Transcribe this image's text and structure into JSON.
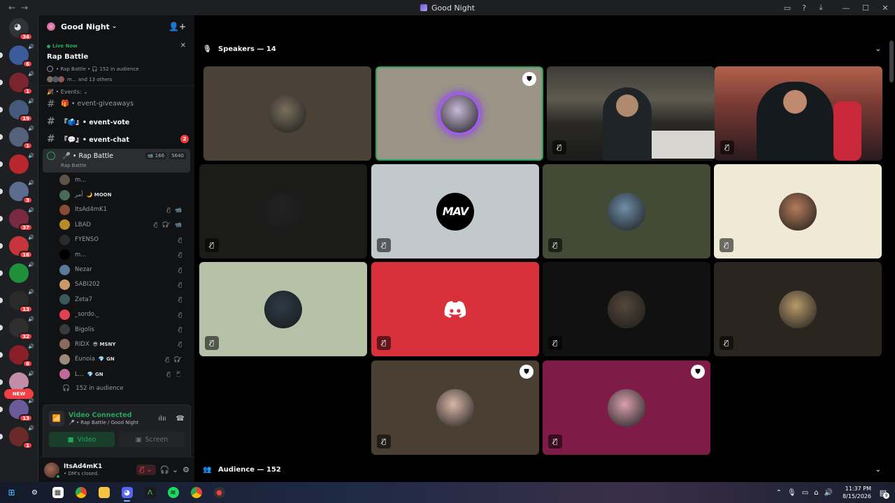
{
  "window": {
    "title": "Good Night",
    "nav_back": "←",
    "nav_forward": "→",
    "minimize": "—",
    "maximize": "☐",
    "close": "✕"
  },
  "servers": {
    "home_badge": "34",
    "items": [
      {
        "badge": "6",
        "color": "#3b5b9a"
      },
      {
        "badge": "1",
        "color": "#7a2430"
      },
      {
        "badge": "19",
        "color": "#455a7a"
      },
      {
        "badge": "1",
        "color": "#55607a"
      },
      {
        "badge": "",
        "color": "#b8262e"
      },
      {
        "badge": "3",
        "color": "#5b6c8f"
      },
      {
        "badge": "37",
        "color": "#7a2a40"
      },
      {
        "badge": "16",
        "color": "#c6353b"
      },
      {
        "badge": "",
        "color": "#1f8f3a"
      },
      {
        "badge": "13",
        "color": "#2a2a2a"
      },
      {
        "badge": "32",
        "color": "#2f2f2f"
      },
      {
        "badge": "6",
        "color": "#8a1f2a"
      },
      {
        "badge": "2",
        "color": "#c08ea8"
      },
      {
        "badge": "13",
        "color": "#6a5a9a"
      },
      {
        "badge": "1",
        "color": "#6a2a2a"
      }
    ],
    "new_label": "NEW"
  },
  "guild": {
    "name": "Good Night",
    "chevron": "⌄",
    "invite_icon": "person-add"
  },
  "live_event": {
    "live_label": "Live Now",
    "title": "Rap Battle",
    "meta": "• Rap Battle •  🎧 152 in audience",
    "members_text": "m... and 13 others"
  },
  "channels": {
    "category": "🎉 • Events: ⌄",
    "items": [
      {
        "name": "🎁 • event-giveaways",
        "unread": false,
        "badge": ""
      },
      {
        "name": "『🗳️』• event-vote",
        "unread": true,
        "badge": ""
      },
      {
        "name": "『💬』• event-chat",
        "unread": true,
        "badge": "2"
      }
    ],
    "voice": {
      "name": "🎤 • Rap Battle",
      "sub": "Rap Battle",
      "cam_count": "166",
      "user_count": "5640"
    },
    "members": [
      {
        "name": "m...",
        "tag": "",
        "icons": "",
        "color": "#5a5346"
      },
      {
        "name": "أمر",
        "tag": "🌙 MOON",
        "icons": "",
        "color": "#4a6a55"
      },
      {
        "name": "ItsAd4mK1",
        "tag": "",
        "icons": "🎙̸ 📹",
        "color": "#8a4a3a"
      },
      {
        "name": "LBAD",
        "tag": "",
        "icons": "🎙̸ 🎧̸ 📹",
        "color": "#b88a2a"
      },
      {
        "name": "FYENSO",
        "tag": "",
        "icons": "🎙̸",
        "color": "#2a2a2a"
      },
      {
        "name": "m...",
        "tag": "",
        "icons": "🎙̸",
        "color": "#000000"
      },
      {
        "name": "Nezar",
        "tag": "",
        "icons": "🎙̸",
        "color": "#5a7a9a"
      },
      {
        "name": "SABI202",
        "tag": "",
        "icons": "🎙̸",
        "color": "#c89a6a"
      },
      {
        "name": "Zeta7",
        "tag": "",
        "icons": "🎙̸",
        "color": "#3a5a5a"
      },
      {
        "name": "_sordo._",
        "tag": "",
        "icons": "🎙̸",
        "color": "#e04050"
      },
      {
        "name": "Bigolis",
        "tag": "",
        "icons": "🎙̸",
        "color": "#3a3a3a"
      },
      {
        "name": "RIDX",
        "tag": "😎 MSNY",
        "icons": "🎙̸",
        "color": "#8a6a5a"
      },
      {
        "name": "Eunoia",
        "tag": "💎 GN",
        "icons": "🎙̸ 🎧̸",
        "color": "#9a8a7a"
      },
      {
        "name": "L...",
        "tag": "💎 GN",
        "icons": "🎙̸ 📱",
        "color": "#c06a9a"
      }
    ],
    "audience": "152 in audience"
  },
  "voice_panel": {
    "status": "Video Connected",
    "location": "🎤 • Rap Battle / Good Night",
    "video_label": "Video",
    "screen_label": "Screen"
  },
  "user": {
    "name": "ItsAd4mK1",
    "status": "• DM's closed."
  },
  "stage": {
    "speakers_label": "Speakers — 14",
    "audience_label": "Audience — 152",
    "tiles": [
      {
        "bg": "#4a4236",
        "avatar": "#7a6f5c",
        "mute": false,
        "mod": false,
        "kind": "avatar"
      },
      {
        "bg": "#9b9487",
        "avatar": "#c9b9d9",
        "mute": false,
        "mod": true,
        "kind": "ring"
      },
      {
        "bg": "#2a2a28",
        "avatar": "",
        "mute": true,
        "mod": false,
        "kind": "video1"
      },
      {
        "bg": "#3a2a2a",
        "avatar": "",
        "mute": true,
        "mod": false,
        "kind": "video2"
      },
      {
        "bg": "#1b1b19",
        "avatar": "#222",
        "mute": true,
        "mod": false,
        "kind": "avatar"
      },
      {
        "bg": "#c2c9cd",
        "avatar": "#000",
        "mute": true,
        "mod": false,
        "kind": "mav",
        "label": "MAV"
      },
      {
        "bg": "#434a35",
        "avatar": "#6e8ea8",
        "mute": true,
        "mod": false,
        "kind": "avatar"
      },
      {
        "bg": "#efe9d6",
        "avatar": "#b57c5a",
        "mute": true,
        "mod": false,
        "kind": "avatar"
      },
      {
        "bg": "#b5c2a8",
        "avatar": "#2c3b48",
        "mute": true,
        "mod": false,
        "kind": "avatar"
      },
      {
        "bg": "#d8313c",
        "avatar": "",
        "mute": true,
        "mod": false,
        "kind": "discord"
      },
      {
        "bg": "#111111",
        "avatar": "#55483a",
        "mute": true,
        "mod": false,
        "kind": "avatar"
      },
      {
        "bg": "#2a251f",
        "avatar": "#b89a6a",
        "mute": true,
        "mod": false,
        "kind": "avatar"
      },
      {
        "bg": "#4a3f33",
        "avatar": "#d9b7a8",
        "mute": true,
        "mod": true,
        "kind": "avatar"
      },
      {
        "bg": "#7e1c47",
        "avatar": "#d9a0b0",
        "mute": true,
        "mod": true,
        "kind": "avatar"
      }
    ]
  },
  "taskbar": {
    "time": "11:37 PM",
    "date": "8/15/2026",
    "notif_count": "9"
  }
}
